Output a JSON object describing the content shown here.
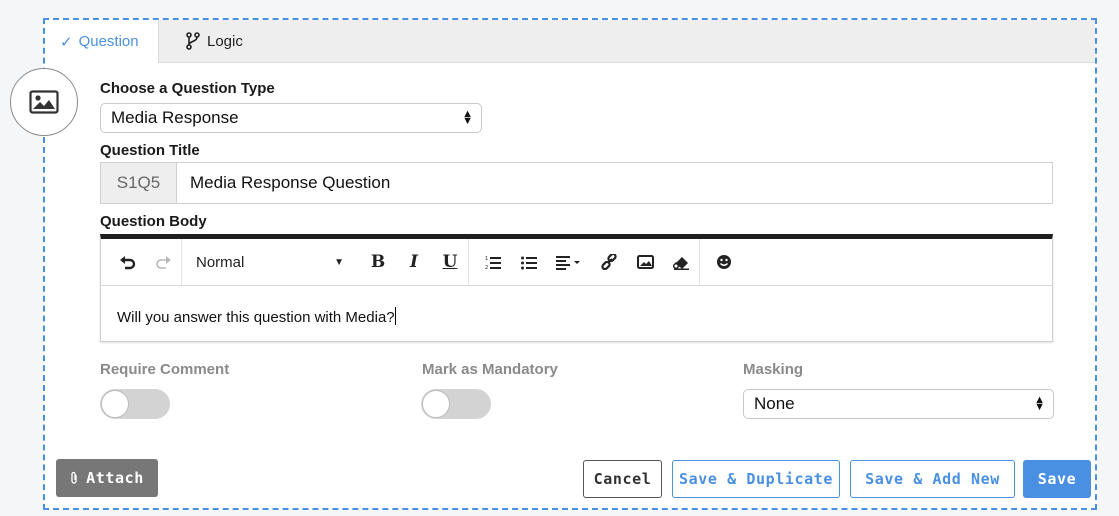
{
  "tabs": [
    {
      "label": "Question",
      "icon": "check-icon",
      "active": true
    },
    {
      "label": "Logic",
      "icon": "branch-icon",
      "active": false
    }
  ],
  "side_icon": "image-icon",
  "question_type": {
    "label": "Choose a Question Type",
    "value": "Media Response"
  },
  "question_title": {
    "label": "Question Title",
    "prefix": "S1Q5",
    "value": "Media Response Question"
  },
  "question_body": {
    "label": "Question Body",
    "format": "Normal",
    "text": "Will you answer this question with Media?",
    "toolbar": [
      "undo-icon",
      "redo-icon",
      "bold-icon",
      "italic-icon",
      "underline-icon",
      "ordered-list-icon",
      "bullet-list-icon",
      "align-icon",
      "link-icon",
      "image-icon",
      "eraser-icon",
      "emoji-icon"
    ]
  },
  "options": {
    "require_comment": {
      "label": "Require Comment",
      "on": false
    },
    "mark_mandatory": {
      "label": "Mark as Mandatory",
      "on": false
    },
    "masking": {
      "label": "Masking",
      "value": "None"
    }
  },
  "buttons": {
    "attach": "Attach",
    "cancel": "Cancel",
    "save_duplicate": "Save & Duplicate",
    "save_add_new": "Save & Add New",
    "save": "Save"
  },
  "colors": {
    "accent": "#4a90e2",
    "attach_bg": "#777777",
    "toggle_off": "#d3d3d3"
  }
}
